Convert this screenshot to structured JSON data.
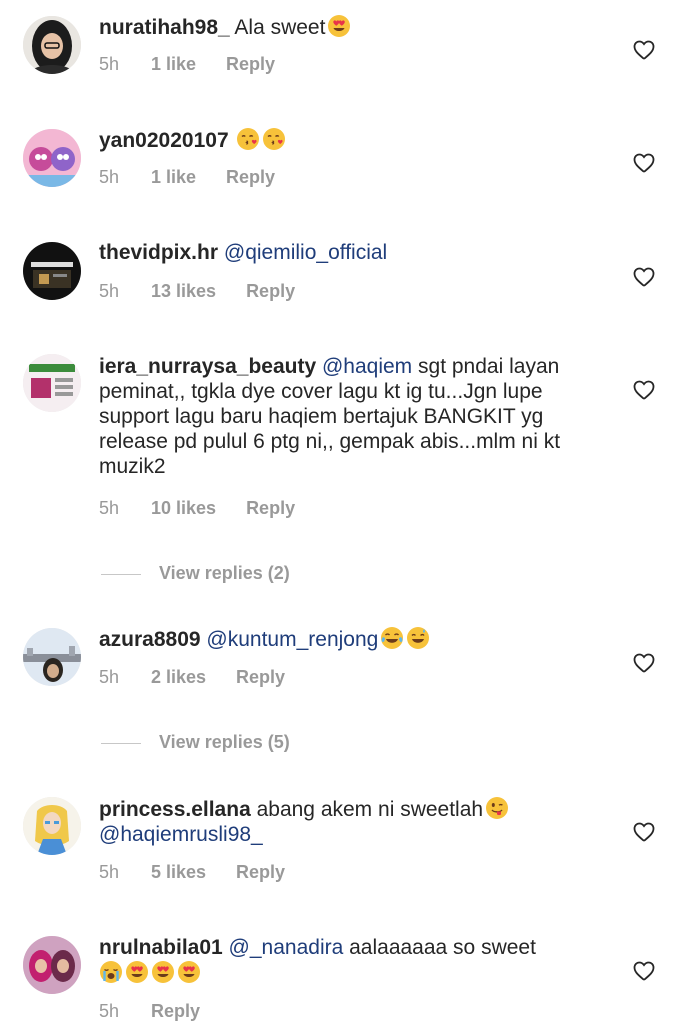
{
  "comments": [
    {
      "username": "nuratihah98_",
      "mention": "",
      "text": "Ala sweet",
      "emojis": [
        "heart-eyes"
      ],
      "time": "5h",
      "likes": "1 like",
      "reply": "Reply"
    },
    {
      "username": "yan02020107",
      "mention": "",
      "text": "",
      "emojis": [
        "kiss-heart",
        "kiss-heart"
      ],
      "time": "5h",
      "likes": "1 like",
      "reply": "Reply"
    },
    {
      "username": "thevidpix.hr",
      "mention": "@qiemilio_official",
      "text": "",
      "emojis": [],
      "time": "5h",
      "likes": "13 likes",
      "reply": "Reply"
    },
    {
      "username": "iera_nurraysa_beauty",
      "mention": "@haqiem",
      "text": "sgt pndai layan peminat,, tgkla dye cover lagu kt ig tu...Jgn lupe support lagu baru haqiem bertajuk BANGKIT yg release pd pulul 6 ptg ni,, gempak abis...mlm ni kt muzik2",
      "emojis": [],
      "time": "5h",
      "likes": "10 likes",
      "reply": "Reply",
      "view_replies": "View replies (2)"
    },
    {
      "username": "azura8809",
      "mention": "@kuntum_renjong",
      "text": "",
      "emojis": [
        "tears-of-joy",
        "grin-sweat"
      ],
      "time": "5h",
      "likes": "2 likes",
      "reply": "Reply",
      "view_replies": "View replies (5)"
    },
    {
      "username": "princess.ellana",
      "mention": "@haqiemrusli98_",
      "text": "abang akem ni sweetlah",
      "emojis": [
        "winking-tongue"
      ],
      "time": "5h",
      "likes": "5 likes",
      "reply": "Reply"
    },
    {
      "username": "nrulnabila01",
      "mention": "@_nanadira",
      "text": "aalaaaaaa so sweet",
      "emojis": [
        "loudly-crying",
        "heart-eyes",
        "heart-eyes",
        "heart-eyes"
      ],
      "time": "5h",
      "likes": "",
      "reply": "Reply"
    }
  ],
  "colors": {
    "text": "#262626",
    "meta": "#999999",
    "mention": "#1f3d7a",
    "emoji_yellow": "#f7c23a",
    "emoji_red": "#e8334a"
  }
}
